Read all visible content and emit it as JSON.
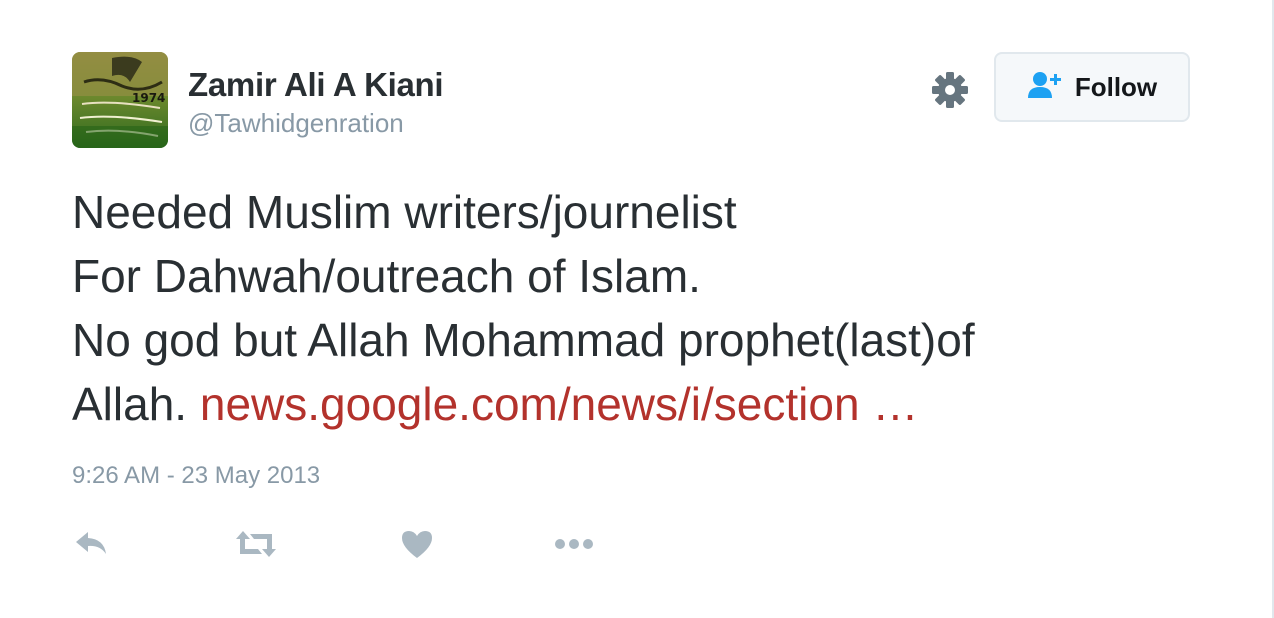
{
  "user": {
    "name": "Zamir Ali A Kiani",
    "handle": "@Tawhidgenration",
    "avatar_text": "1974"
  },
  "header": {
    "follow_label": "Follow",
    "settings_icon": "gear-icon",
    "follow_icon": "add-user-icon"
  },
  "tweet": {
    "line1": "Needed Muslim writers/journelist",
    "line2": "For Dahwah/outreach of Islam.",
    "line3": "No god but Allah Mohammad prophet(last)of",
    "line4_prefix": "Allah. ",
    "link_text": "news.google.com/news/i/section …",
    "timestamp": "9:26 AM - 23 May 2013"
  },
  "actions": {
    "icons": [
      "reply-icon",
      "retweet-icon",
      "heart-icon",
      "more-icon"
    ]
  },
  "colors": {
    "text": "#292f33",
    "muted": "#8899a6",
    "link": "#b3322c",
    "follow_icon": "#1da1f2",
    "border": "#e1e8ed"
  }
}
